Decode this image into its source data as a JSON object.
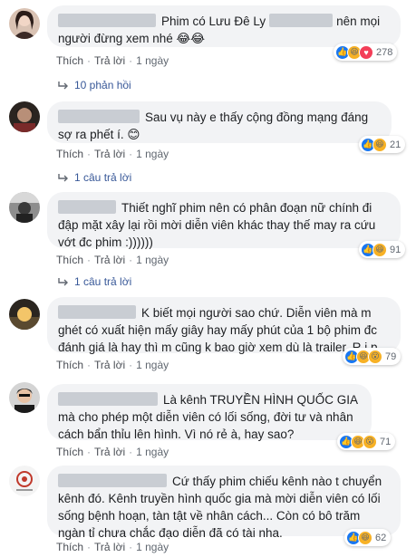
{
  "actions": {
    "like": "Thích",
    "reply": "Trả lời",
    "sep": "·"
  },
  "comments": [
    {
      "text_before": "Phim có Lưu Đê Ly",
      "text_after": "nên mọi người đừng xem nhé 😂😂",
      "time": "1 ngày",
      "reaction_count": "278",
      "replies": "10 phản hồi"
    },
    {
      "text": "Sau vụ này e thấy cộng đồng mạng đáng sợ ra phết í. 😊",
      "time": "1 ngày",
      "reaction_count": "21",
      "replies": "1 câu trả lời"
    },
    {
      "text": "Thiết nghĩ phim nên có phân đoạn nữ chính đi đập mặt xây lại rồi mời diễn viên khác thay thế may ra cứu vớt đc phim :))))))",
      "time": "1 ngày",
      "reaction_count": "91",
      "replies": "1 câu trả lời"
    },
    {
      "text": "K biết mọi người sao chứ. Diễn viên mà m ghét có xuất hiện mấy giây hay mấy phút của 1 bộ phim đc đánh giá là hay thì m cũng k bao giờ xem dù là trailer. R.i.p",
      "time": "1 ngày",
      "reaction_count": "79"
    },
    {
      "text": "Là kênh TRUYỀN HÌNH QUỐC GIA mà cho phép một diễn viên có lối sống, đời tư và nhân cách bẩn thỉu lên hình. Vì nó rẻ à, hay sao?",
      "time": "1 ngày",
      "reaction_count": "71"
    },
    {
      "text": "Cứ thấy phim chiếu kênh nào t chuyển kênh đó. Kênh truyền hình quốc gia mà mời diễn viên có lối sống bệnh hoạn, tàn tật về nhân cách... Còn có bô trăm ngàn tỉ chưa chắc đạo diễn đã có tài nha.",
      "time": "1 ngày",
      "reaction_count": "62"
    }
  ],
  "colors": {
    "like": "#1877f2",
    "haha": "#f7b125",
    "love": "#f33e58",
    "bubble": "#f2f3f5",
    "link": "#385898"
  }
}
